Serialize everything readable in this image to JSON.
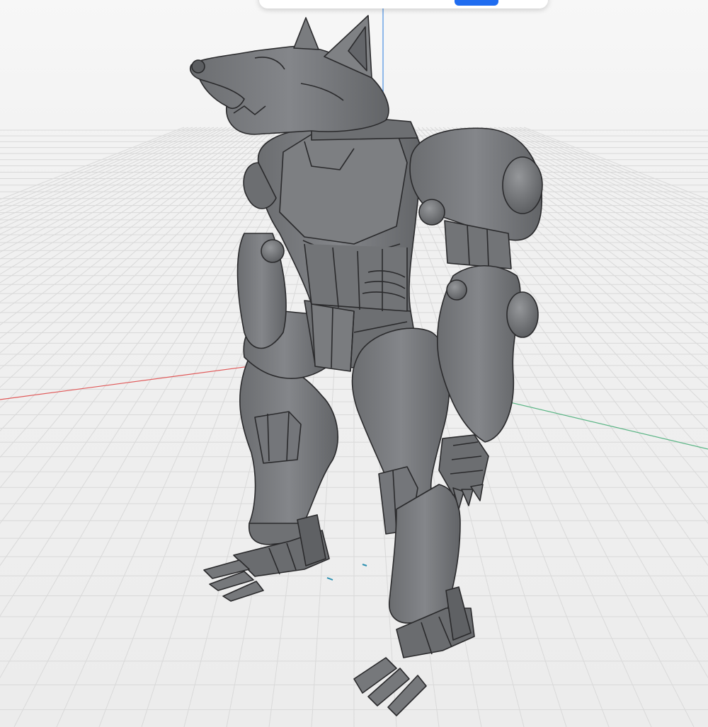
{
  "viewport": {
    "background": "#f3f3f3",
    "grid_color": "#d9d9d9",
    "axes": {
      "x_color": "#e05a5a",
      "y_color": "#5bb585",
      "z_color": "#4a90e2"
    }
  },
  "model": {
    "name_icon": "werewolf-robot-model",
    "fill": "#787a7d",
    "shade": "#5e6063",
    "highlight": "#8f9194",
    "edge_color": "#2a2a2c"
  },
  "top_panel": {
    "button_label": "",
    "button_color": "#1f6cf0"
  }
}
